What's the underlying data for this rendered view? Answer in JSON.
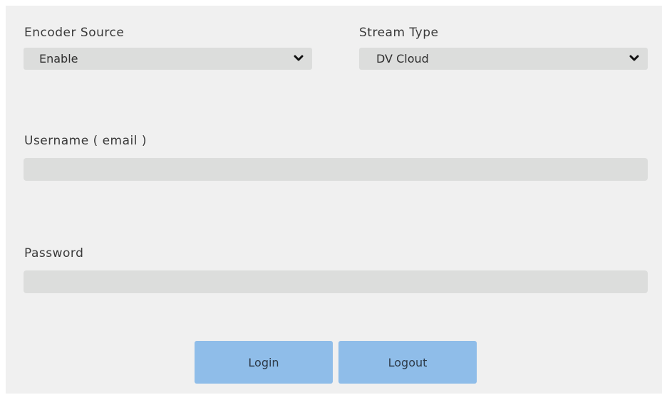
{
  "encoder_source": {
    "label": "Encoder Source",
    "selected": "Enable"
  },
  "stream_type": {
    "label": "Stream Type",
    "selected": "DV Cloud"
  },
  "username": {
    "label": "Username ( email )",
    "value": ""
  },
  "password": {
    "label": "Password",
    "value": ""
  },
  "buttons": {
    "login": "Login",
    "logout": "Logout"
  },
  "colors": {
    "panel_bg": "#f0f0f0",
    "field_bg": "#dcdddc",
    "button_bg": "#8fbde9"
  },
  "icons": {
    "dropdown": "chevron-down-icon"
  }
}
